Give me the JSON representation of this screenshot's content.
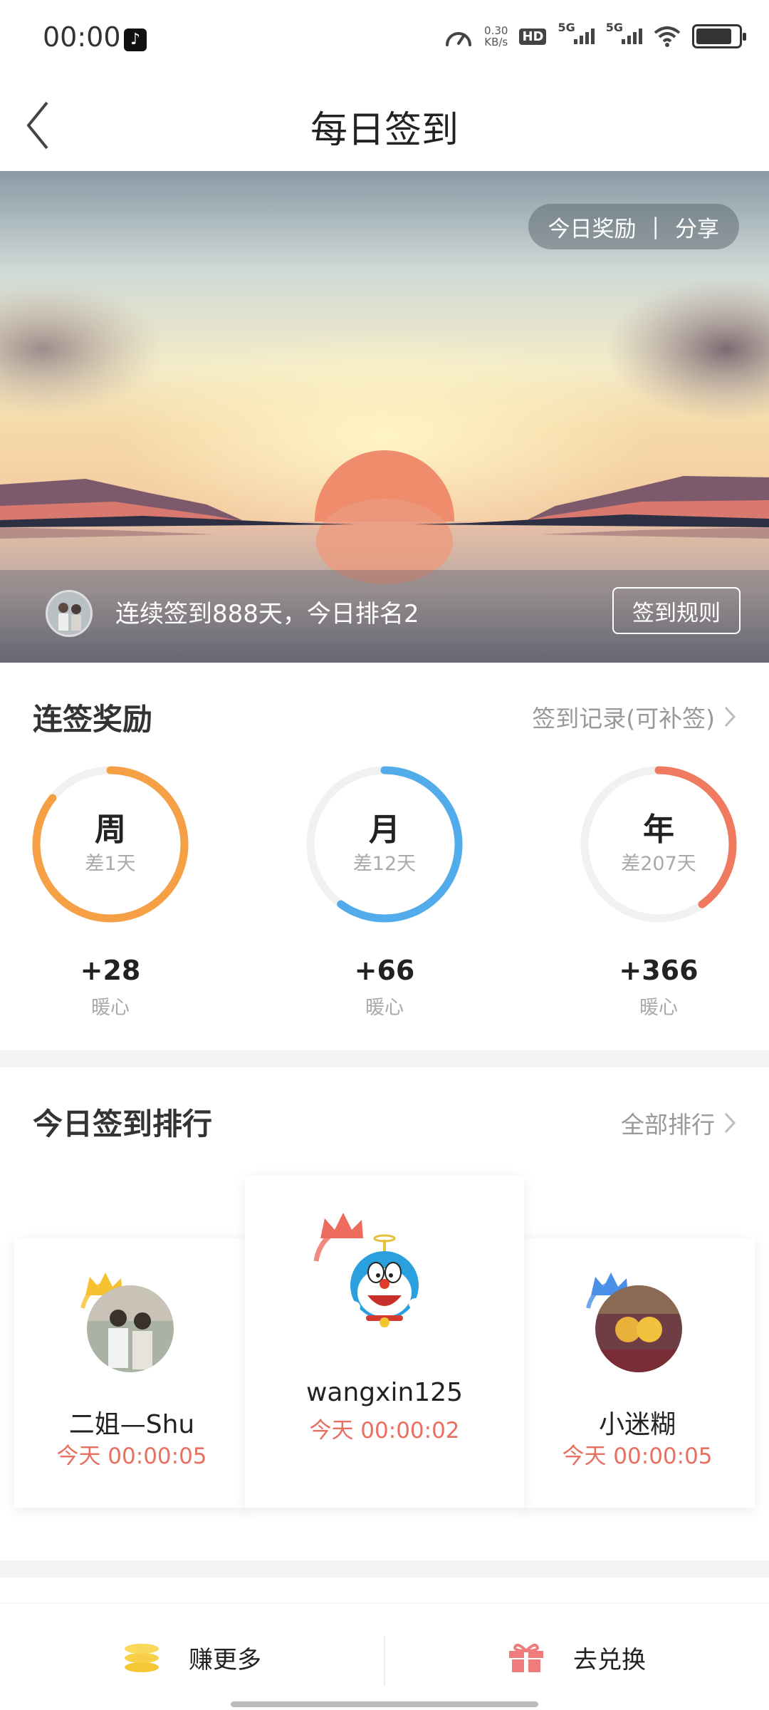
{
  "status_bar": {
    "time": "00:00",
    "net_speed_value": "0.30",
    "net_speed_unit": "KB/s",
    "hd_label": "HD",
    "signal1_label": "5G",
    "signal2_label": "5G"
  },
  "header": {
    "title": "每日签到"
  },
  "banner": {
    "today_reward": "今日奖励",
    "separator": "|",
    "share": "分享",
    "streak_text": "连续签到888天，今日排名2",
    "rules_button": "签到规则"
  },
  "rewards": {
    "title": "连签奖励",
    "record_link": "签到记录(可补签)",
    "items": [
      {
        "period": "周",
        "remaining": "差1天",
        "bonus": "+28",
        "unit": "暖心",
        "color": "#F5A044",
        "progress": 0.857
      },
      {
        "period": "月",
        "remaining": "差12天",
        "bonus": "+66",
        "unit": "暖心",
        "color": "#52ACEB",
        "progress": 0.6
      },
      {
        "period": "年",
        "remaining": "差207天",
        "bonus": "+366",
        "unit": "暖心",
        "color": "#EF7A5F",
        "progress": 0.4
      }
    ]
  },
  "ranking": {
    "title": "今日签到排行",
    "all_link": "全部排行",
    "entries": [
      {
        "name": "二姐—Shu",
        "time": "今天 00:00:05",
        "crown_color": "#F5C12E"
      },
      {
        "name": "wangxin125",
        "time": "今天 00:00:02",
        "crown_color": "#EC6C5E"
      },
      {
        "name": "小迷糊",
        "time": "今天 00:00:05",
        "crown_color": "#4B8FE8"
      }
    ]
  },
  "bottom_bar": {
    "earn_more": "赚更多",
    "redeem": "去兑换"
  }
}
